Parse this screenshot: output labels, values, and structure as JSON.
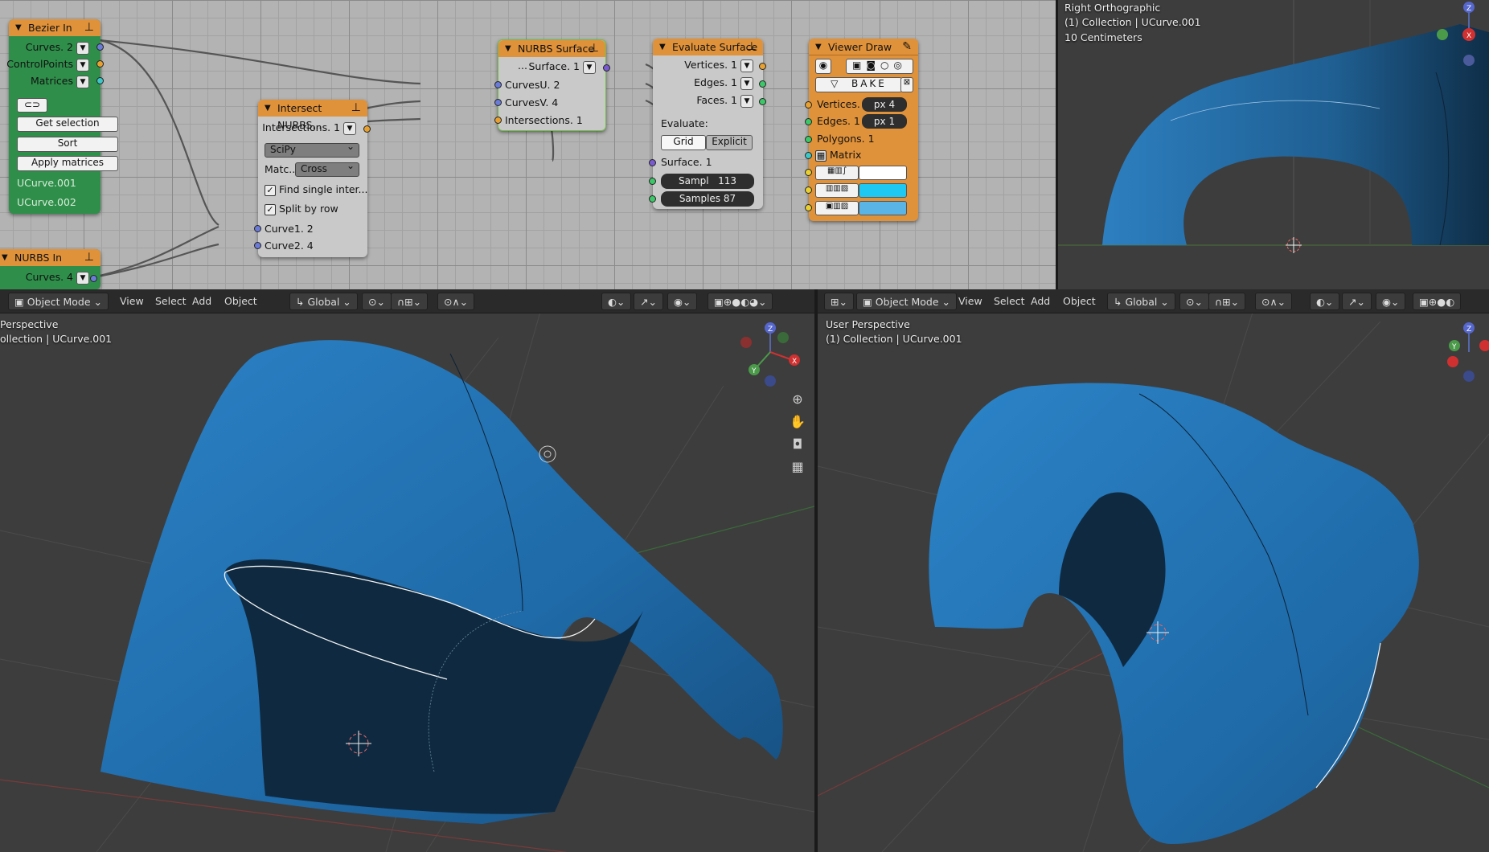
{
  "node_editor": {
    "bezier_in": {
      "title": "Bezier In",
      "outputs": [
        "Curves. 2",
        "ControlPoints",
        "Matrices"
      ],
      "buttons": [
        "Get selection",
        "Sort",
        "Apply matrices"
      ],
      "items": [
        "UCurve.001",
        "UCurve.002"
      ]
    },
    "nurbs_in": {
      "title": "NURBS In",
      "output": "Curves. 4"
    },
    "intersect": {
      "title": "Intersect NURBS...",
      "output": "Intersections. 1",
      "implementation": "SciPy",
      "matching_label": "Matc...",
      "matching_value": "Cross",
      "check1": "Find single inter...",
      "check2": "Split by row",
      "inputs": [
        "Curve1. 2",
        "Curve2. 4"
      ]
    },
    "nurbs_surface": {
      "title": "NURBS Surface ...",
      "output": "Surface. 1",
      "inputs": [
        "CurvesU. 2",
        "CurvesV. 4",
        "Intersections. 1"
      ]
    },
    "evaluate": {
      "title": "Evaluate Surface",
      "outputs": [
        "Vertices. 1",
        "Edges. 1",
        "Faces. 1"
      ],
      "evaluate_label": "Evaluate:",
      "mode_grid": "Grid",
      "mode_explicit": "Explicit",
      "input_surface": "Surface. 1",
      "sampl_label": "Sampl",
      "sampl_value": "113",
      "samples_label": "Samples",
      "samples_value": "87"
    },
    "viewer": {
      "title": "Viewer Draw",
      "bake": "BAKE",
      "inputs": [
        "Vertices. 1",
        "Edges. 1",
        "Polygons. 1",
        "Matrix"
      ],
      "vert_px": "px  4",
      "edge_px": "px  1",
      "color_vert": "#ffffff",
      "color_edge": "#1ec8f0",
      "color_poly": "#5ab4e6"
    }
  },
  "top_right_view": {
    "title": "Right Orthographic",
    "collection": "(1) Collection | UCurve.001",
    "scale": "10 Centimeters"
  },
  "left_view": {
    "mode": "Object Mode",
    "menus": [
      "View",
      "Select",
      "Add",
      "Object"
    ],
    "orientation": "Global",
    "title": "Perspective",
    "collection": "ollection | UCurve.001"
  },
  "right_view": {
    "mode": "Object Mode",
    "menus": [
      "View",
      "Select",
      "Add",
      "Object"
    ],
    "orientation": "Global",
    "title": "User Perspective",
    "collection": "(1) Collection | UCurve.001"
  },
  "colors": {
    "node_green": "#2f8f4a",
    "node_orange": "#e0923a",
    "node_grey": "#c9c9c9",
    "surface": "#2a78b5"
  }
}
